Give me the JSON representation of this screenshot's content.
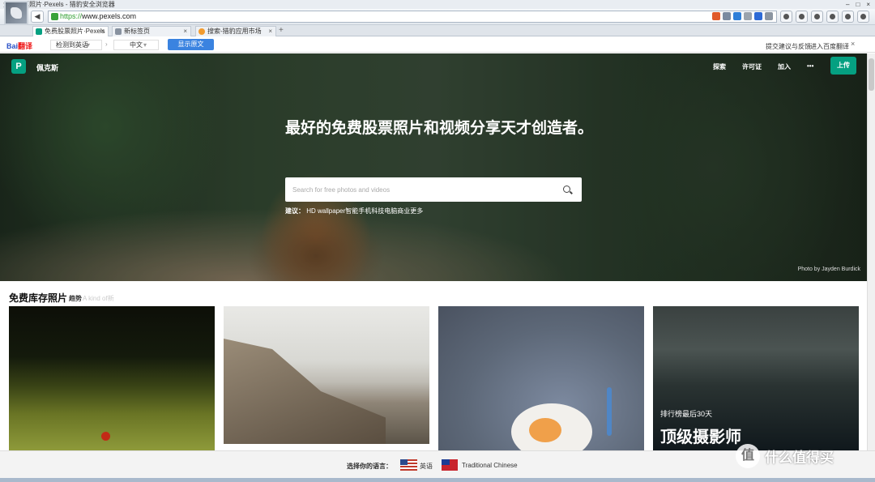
{
  "window": {
    "title": "免费股票照片·Pexels - 猎豹安全浏览器"
  },
  "toolbar": {
    "url_scheme": "https://",
    "url_rest": "www.pexels.com"
  },
  "tabs": [
    {
      "label": "免费股票照片·Pexels",
      "active": true,
      "icon_color": "#05a081"
    },
    {
      "label": "新标签页",
      "active": false,
      "icon_color": "#8892a0"
    },
    {
      "label": "搜索-猎豹应用市场",
      "active": false,
      "icon_color": "#f29b2e"
    }
  ],
  "translate": {
    "brand_1": "Bai",
    "brand_2": "翻译",
    "source_lang": "检测到英语",
    "target_lang": "中文",
    "show_original": "显示原文",
    "feedback": "提交建议与反馈",
    "enter_baidu": "进入百度翻译",
    "close": "×"
  },
  "hero": {
    "logo_letter": "P",
    "logo_text": "佩克斯",
    "nav": {
      "explore": "探索",
      "license": "许可证",
      "join": "加入",
      "more": "•••",
      "upload": "上传"
    },
    "headline": "最好的免费股票照片和视频分享天才创造者。",
    "search_placeholder": "Search for free photos and videos",
    "suggest_label": "建议：",
    "suggest_items": "HD wallpaper智能手机科技电脑商业更多",
    "credit": "Photo by Jayden Burdick"
  },
  "section": {
    "title": "免费库存照片",
    "trend": "趋势",
    "kind": "A kind of新"
  },
  "featured": {
    "subtitle": "排行榜最后30天",
    "title": "顶级摄影师"
  },
  "language_bar": {
    "prompt": "选择你的语言：",
    "lang_en": "英语",
    "lang_tc": "Traditional Chinese"
  },
  "watermark": {
    "glyph": "值",
    "text": "什么值得买"
  },
  "colors": {
    "brand_green": "#05a081",
    "translate_blue": "#3a83e0"
  }
}
